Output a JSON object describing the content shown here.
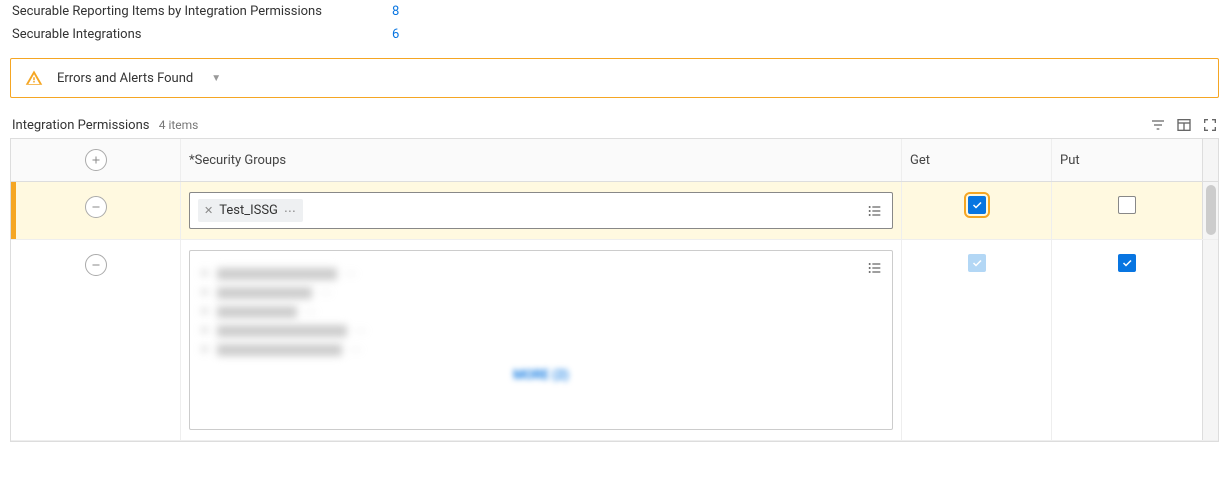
{
  "summary": [
    {
      "label": "Securable Reporting Items by Integration Permissions",
      "value": "8"
    },
    {
      "label": "Securable Integrations",
      "value": "6"
    }
  ],
  "alert": {
    "text": "Errors and Alerts Found"
  },
  "table": {
    "title": "Integration Permissions",
    "items_count": "4 items",
    "columns": {
      "security_groups": "*Security Groups",
      "get": "Get",
      "put": "Put"
    },
    "rows": [
      {
        "highlighted": true,
        "chips": [
          {
            "label": "Test_ISSG"
          }
        ],
        "get_checked": true,
        "get_focused": true,
        "put_checked": false
      },
      {
        "highlighted": false,
        "redacted_items": [
          120,
          95,
          80,
          130,
          125
        ],
        "more_label": "MORE (2)",
        "get_checked": true,
        "get_light": true,
        "put_checked": true
      }
    ]
  }
}
